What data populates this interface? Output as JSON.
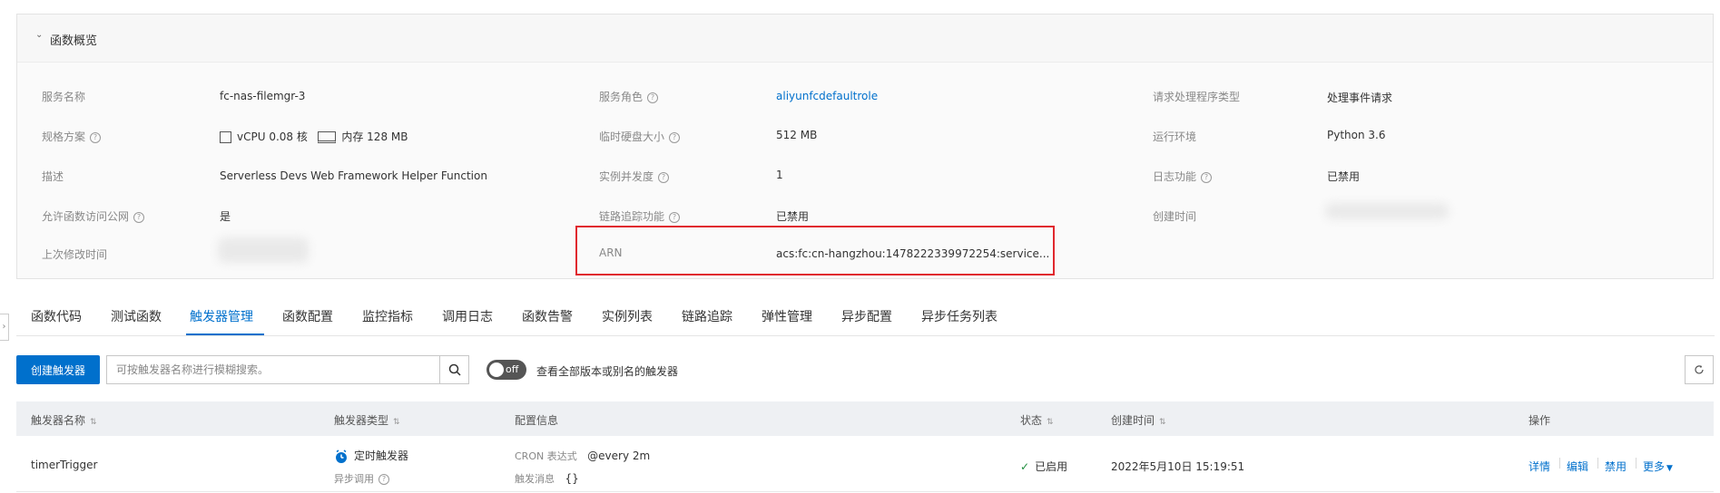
{
  "overview": {
    "title": "函数概览",
    "fields": {
      "service_name": {
        "label": "服务名称",
        "value": "fc-nas-filemgr-3"
      },
      "service_role": {
        "label": "服务角色",
        "value": "aliyunfcdefaultrole"
      },
      "handler_type": {
        "label": "请求处理程序类型",
        "value": "处理事件请求"
      },
      "spec": {
        "label": "规格方案",
        "cpu_label": "vCPU",
        "cpu_value": "0.08 核",
        "mem_label": "内存",
        "mem_value": "128 MB"
      },
      "disk": {
        "label": "临时硬盘大小",
        "value": "512 MB"
      },
      "runtime": {
        "label": "运行环境",
        "value": "Python 3.6"
      },
      "description": {
        "label": "描述",
        "value": "Serverless Devs Web Framework Helper Function"
      },
      "concurrency": {
        "label": "实例并发度",
        "value": "1"
      },
      "logging": {
        "label": "日志功能",
        "value": "已禁用"
      },
      "internet": {
        "label": "允许函数访问公网",
        "value": "是"
      },
      "tracing": {
        "label": "链路追踪功能",
        "value": "已禁用"
      },
      "created": {
        "label": "创建时间"
      },
      "modified": {
        "label": "上次修改时间"
      },
      "arn": {
        "label": "ARN",
        "value": "acs:fc:cn-hangzhou:1478222339972254:service..."
      }
    }
  },
  "tabs": [
    "函数代码",
    "测试函数",
    "触发器管理",
    "函数配置",
    "监控指标",
    "调用日志",
    "函数告警",
    "实例列表",
    "链路追踪",
    "弹性管理",
    "异步配置",
    "异步任务列表"
  ],
  "active_tab": "触发器管理",
  "toolbar": {
    "create_label": "创建触发器",
    "search_placeholder": "可按触发器名称进行模糊搜索。",
    "toggle_text": "off",
    "toggle_label": "查看全部版本或别名的触发器"
  },
  "table": {
    "headers": [
      "触发器名称",
      "触发器类型",
      "配置信息",
      "状态",
      "创建时间",
      "操作"
    ],
    "rows": [
      {
        "name": "timerTrigger",
        "type": "定时触发器",
        "invoke": "异步调用",
        "cron_label": "CRON 表达式",
        "cron_value": "@every 2m",
        "msg_label": "触发消息",
        "msg_value": "{}",
        "status": "已启用",
        "created": "2022年5月10日 15:19:51",
        "actions": [
          "详情",
          "编辑",
          "禁用",
          "更多"
        ]
      }
    ]
  },
  "colors": {
    "accent": "#0070cc",
    "highlight_box": "#e0282e",
    "success": "#1e8e3e"
  }
}
